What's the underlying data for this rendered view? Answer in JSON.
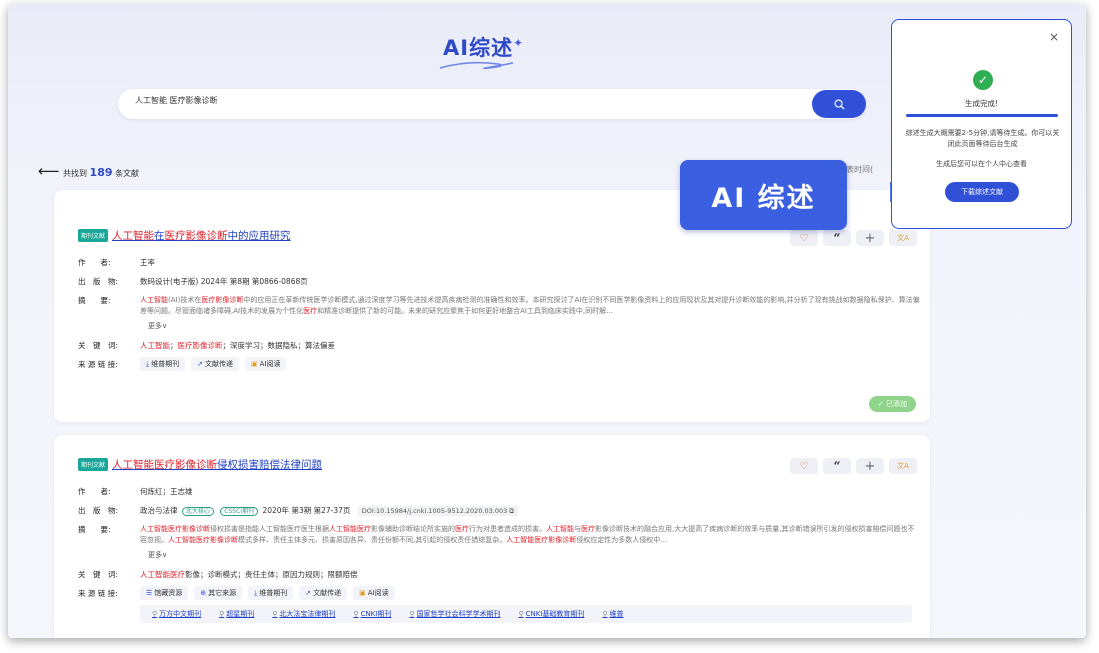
{
  "header": {
    "logo_text": "AI综述",
    "logo_spark": "✦"
  },
  "search": {
    "query": "人工智能 医疗影像诊断"
  },
  "results": {
    "prefix": "共找到",
    "count": "189",
    "suffix": "条文献",
    "sort_label": "发表时间("
  },
  "labels": {
    "author": "作　　者:",
    "publisher": "出　版　物:",
    "abstract": "摘　　要:",
    "keywords": "关　键　词:",
    "links": "来 源 链 接:",
    "more": "更多∨"
  },
  "card1": {
    "tag": "期刊文献",
    "title_segments": [
      {
        "t": "人工智能",
        "hl": true
      },
      {
        "t": "在",
        "hl": false
      },
      {
        "t": "医疗影像诊断",
        "hl": true
      },
      {
        "t": "中的应用研究",
        "hl": false
      }
    ],
    "author": "王率",
    "publisher": "数码设计(电子版)  2024年 第8期 第0866-0868页",
    "abstract_segments": [
      {
        "t": "人工智能",
        "hl": true
      },
      {
        "t": "(AI)技术在",
        "hl": false
      },
      {
        "t": "医疗影像诊断",
        "hl": true
      },
      {
        "t": "中的应用正在革新传统医学诊断模式,通过深度学习等先进技术提高疾病检测的准确性和效率。本研究探讨了AI在识别不同医学影像资料上的应用现状及其对提升诊断效能的影响,并分析了现有挑战如数据隐私保护、算法偏差等问题。尽管面临诸多障碍,AI技术的发展为个性化",
        "hl": false
      },
      {
        "t": "医疗",
        "hl": true
      },
      {
        "t": "和精准诊断提供了新的可能。未来的研究应聚焦于如何更好地整合AI工具到临床实践中,同时解…",
        "hl": false
      }
    ],
    "keywords": [
      {
        "t": "人工智能",
        "hl": true
      },
      {
        "t": "；",
        "hl": false
      },
      {
        "t": "医疗影像诊断",
        "hl": true
      },
      {
        "t": "；深度学习；数据隐私；算法偏差",
        "hl": false
      }
    ],
    "links": [
      {
        "icon": "⤓",
        "label": "维普期刊"
      },
      {
        "icon": "➚",
        "label": "文献传递"
      },
      {
        "icon": "▣",
        "label": "AI阅读"
      }
    ],
    "added_label": "✓ 已添加"
  },
  "card2": {
    "tag": "期刊文献",
    "title_segments": [
      {
        "t": "人工智能医疗影像诊断",
        "hl": true
      },
      {
        "t": "侵权损害赔偿法律问题",
        "hl": false
      }
    ],
    "author": "何炼红；王志雄",
    "publisher_prefix": "政治与法律",
    "badge1": "北大核心",
    "badge2": "CSSCI期刊",
    "publisher_suffix": "2020年 第3期 第27-37页",
    "doi": "DOI:10.15984/j.cnki.1005-9512.2020.03.003 ⧉",
    "abstract_segments": [
      {
        "t": "人工智能医疗影像诊断",
        "hl": true
      },
      {
        "t": "侵权损害是指能人工智能医疗医生根据",
        "hl": false
      },
      {
        "t": "人工智能医疗",
        "hl": true
      },
      {
        "t": "影像辅助诊断结论所实施的",
        "hl": false
      },
      {
        "t": "医疗",
        "hl": true
      },
      {
        "t": "行为对患者造成的损害。",
        "hl": false
      },
      {
        "t": "人工智能",
        "hl": true
      },
      {
        "t": "与",
        "hl": false
      },
      {
        "t": "医疗",
        "hl": true
      },
      {
        "t": "影像诊断技术的融合应用,大大提高了疾病诊断的效率与质量,其诊断错误所引发的侵权损害赔偿问题也不容忽视。",
        "hl": false
      },
      {
        "t": "人工智能医疗影像诊断",
        "hl": true
      },
      {
        "t": "模式多样、责任主体多元、损害原因各异、责任份额不同,其引起的侵权责任错综复杂。",
        "hl": false
      },
      {
        "t": "人工智能医疗影像诊断",
        "hl": true
      },
      {
        "t": "侵权应定性为多数人侵权中…",
        "hl": false
      }
    ],
    "keywords": [
      {
        "t": "人工智能医疗",
        "hl": true
      },
      {
        "t": "影像；诊断模式；责任主体；原因力规则；限额赔偿",
        "hl": false
      }
    ],
    "links": [
      {
        "icon": "☰",
        "label": "馆藏资源"
      },
      {
        "icon": "⊕",
        "label": "其它来源"
      },
      {
        "icon": "⤓",
        "label": "维普期刊"
      },
      {
        "icon": "➚",
        "label": "文献传递"
      },
      {
        "icon": "▣",
        "label": "AI阅读"
      }
    ],
    "sources": [
      "万方中文期刊",
      "超星期刊",
      "北大法宝法律期刊",
      "CNKI期刊",
      "国家哲学社会科学学术期刊",
      "CNKI基础教育期刊",
      "维普"
    ]
  },
  "popup": {
    "close": "×",
    "check": "✓",
    "status": "生成完成!",
    "desc": "综述生成大概需要2-5分钟,请等待生成。你可以关闭此页面等待后台生成",
    "desc2": "生成后您可以在个人中心查看",
    "download_label": "下载综述文献"
  },
  "callout": {
    "text": "AI 综述"
  },
  "colors": {
    "accent": "#3050d8",
    "highlight": "#e0202a",
    "tag": "#1aa698",
    "success": "#2fae53"
  }
}
